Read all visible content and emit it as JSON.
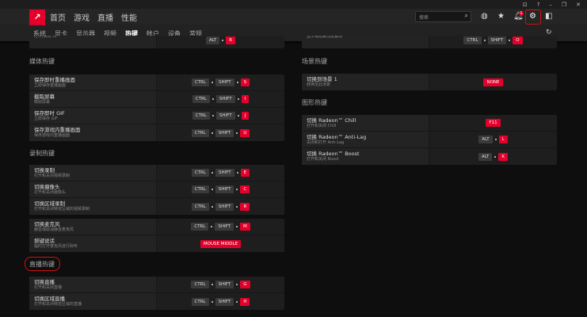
{
  "window": {
    "controls": [
      "⊡",
      "?",
      "–",
      "❐",
      "✕"
    ]
  },
  "header": {
    "logo": "AMD",
    "nav": [
      "首页",
      "游戏",
      "直播",
      "性能"
    ],
    "search_placeholder": "搜索",
    "notification_count": "1"
  },
  "subnav": {
    "items": [
      "系统",
      "显卡",
      "显示器",
      "视频",
      "热键",
      "帐户",
      "设备",
      "常规"
    ],
    "active": 4
  },
  "left": {
    "top_partial": {
      "subtitle": "打开/关闭 UI",
      "keys": [
        "ALT",
        "R"
      ]
    },
    "sections": [
      {
        "title": "媒体热键",
        "cards": [
          [
            {
              "title": "保存即时重播画面",
              "subtitle": "立即保存重播画面",
              "keys": [
                "CTRL",
                "SHIFT",
                "S"
              ]
            },
            {
              "title": "截取屏幕",
              "subtitle": "截取屏幕",
              "keys": [
                "CTRL",
                "SHIFT",
                "I"
              ]
            },
            {
              "title": "保存即时 GIF",
              "subtitle": "立即保存 GIF",
              "keys": [
                "CTRL",
                "SHIFT",
                "J"
              ]
            },
            {
              "title": "保存游戏内重播画面",
              "subtitle": "保存游戏内重播画面",
              "keys": [
                "CTRL",
                "SHIFT",
                "U"
              ]
            }
          ]
        ]
      },
      {
        "title": "录制热键",
        "cards": [
          [
            {
              "title": "切换录制",
              "subtitle": "打开和关闭视频录制",
              "keys": [
                "CTRL",
                "SHIFT",
                "E"
              ]
            },
            {
              "title": "切换摄像头",
              "subtitle": "打开和关闭摄像头",
              "keys": [
                "CTRL",
                "SHIFT",
                "C"
              ]
            },
            {
              "title": "切换区域录制",
              "subtitle": "打开和关闭特定区域的视频录制",
              "keys": [
                "CTRL",
                "SHIFT",
                "R"
              ]
            }
          ],
          [
            {
              "title": "切换麦克风",
              "subtitle": "静音或取消静音麦克风",
              "keys": [
                "CTRL",
                "SHIFT",
                "M"
              ]
            },
            {
              "title": "按键说话",
              "subtitle": "临时打开麦克风进行聆听",
              "keys": [
                "MOUSE MIDDLE"
              ]
            }
          ]
        ]
      },
      {
        "title": "直播热键",
        "cards": [
          [
            {
              "title": "切换直播",
              "subtitle": "打开和关闭直播",
              "keys": [
                "CTRL",
                "SHIFT",
                "G"
              ]
            },
            {
              "title": "切换区域直播",
              "subtitle": "打开和关闭特定区域的直播",
              "keys": [
                "CTRL",
                "SHIFT",
                "H"
              ]
            }
          ]
        ]
      }
    ]
  },
  "right": {
    "top_partial": {
      "subtitle": "显示或隐藏性能叠加",
      "keys": [
        "CTRL",
        "SHIFT",
        "O"
      ]
    },
    "sections": [
      {
        "title": "场景热键",
        "cards": [
          [
            {
              "title": "切换到场景 1",
              "subtitle": "转换至此场景",
              "keys": [
                "NONE"
              ]
            }
          ]
        ]
      },
      {
        "title": "图形热键",
        "cards": [
          [
            {
              "title": "切换 Radeon™ Chill",
              "subtitle": "打开和关闭 Chill",
              "keys": [
                "F11"
              ]
            },
            {
              "title": "切换 Radeon™ Anti-Lag",
              "subtitle": "关闭和打开 Anti-Lag",
              "keys": [
                "ALT",
                "L"
              ]
            },
            {
              "title": "切换 Radeon™ Boost",
              "subtitle": "打开和关闭 Boost",
              "keys": [
                "ALT",
                "K"
              ]
            }
          ]
        ]
      }
    ]
  },
  "colors": {
    "accent": "#e4002b",
    "annotation": "#d01010"
  }
}
